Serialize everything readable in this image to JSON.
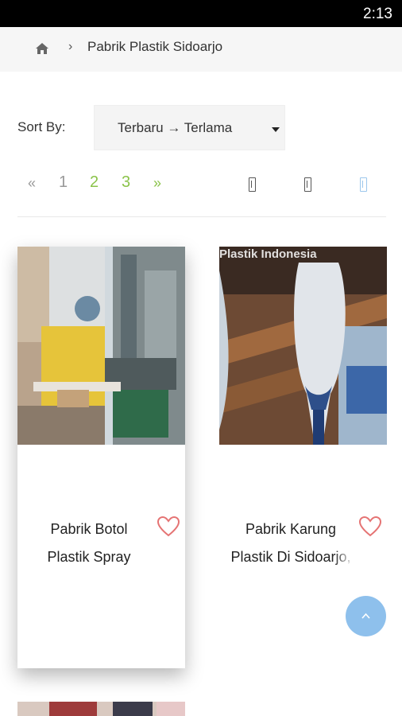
{
  "status_bar": {
    "time": "2:13"
  },
  "breadcrumb": {
    "home_icon": "home-icon",
    "separator": "›",
    "current": "Pabrik Plastik Sidoarjo"
  },
  "sort": {
    "label": "Sort By:",
    "selected": "Terbaru → Terlama"
  },
  "pagination": {
    "prev": "«",
    "pages": [
      "1",
      "2",
      "3"
    ],
    "next": "»",
    "current_page": "1"
  },
  "view_toggles": [
    "list-view-icon",
    "grid-view-icon",
    "large-view-icon"
  ],
  "products": [
    {
      "title_line1": "Pabrik Botol",
      "title_line2": "Plastik Spray",
      "favorite_icon": "heart-outline-icon"
    },
    {
      "title_line1": "Pabrik Karung",
      "title_line2": "Plastik Di Sidoarjo,",
      "watermark": "Plastik Indonesia",
      "favorite_icon": "heart-outline-icon"
    }
  ],
  "colors": {
    "accent": "#8bc34a",
    "heart": "#e57373",
    "fab": "#8ec0ec"
  }
}
